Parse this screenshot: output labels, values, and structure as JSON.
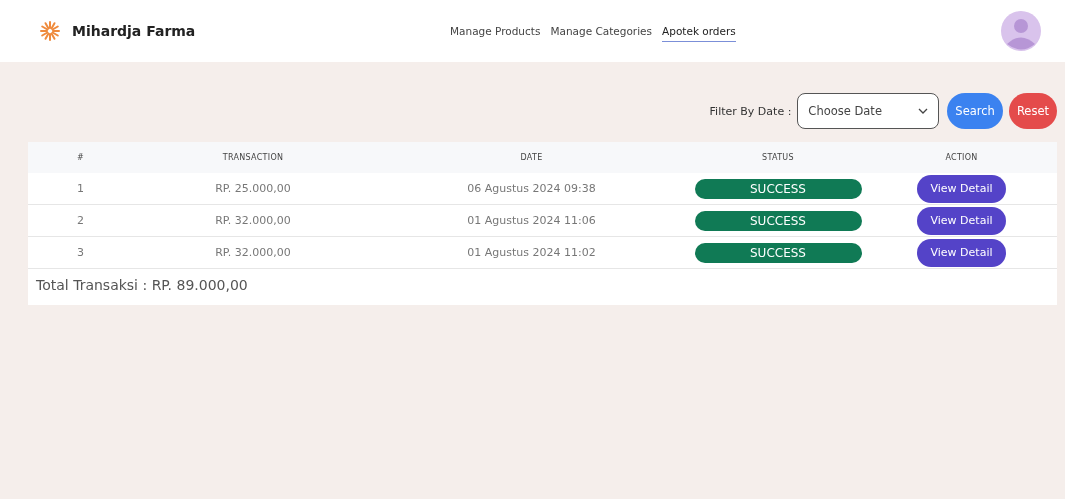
{
  "brand": {
    "name": "Mihardja Farma"
  },
  "nav": [
    {
      "label": "Manage Products",
      "selected": false
    },
    {
      "label": "Manage Categories",
      "selected": false
    },
    {
      "label": "Apotek orders",
      "selected": true
    }
  ],
  "filter": {
    "label": "Filter By Date :",
    "placeholder": "Choose Date",
    "buttons": [
      {
        "label": "Search",
        "kind": "primary"
      },
      {
        "label": "Reset",
        "kind": "danger"
      }
    ]
  },
  "table": {
    "columns": [
      "#",
      "TRANSACTION",
      "DATE",
      "STATUS",
      "ACTION"
    ],
    "rows": [
      {
        "no": "1",
        "transaction": "RP. 25.000,00",
        "date": "06 Agustus 2024 09:38",
        "status": "SUCCESS",
        "action": "View Detail"
      },
      {
        "no": "2",
        "transaction": "RP. 32.000,00",
        "date": "01 Agustus 2024 11:06",
        "status": "SUCCESS",
        "action": "View Detail"
      },
      {
        "no": "3",
        "transaction": "RP. 32.000,00",
        "date": "01 Agustus 2024 11:02",
        "status": "SUCCESS",
        "action": "View Detail"
      }
    ],
    "total": "Total Transaksi : RP. 89.000,00"
  }
}
